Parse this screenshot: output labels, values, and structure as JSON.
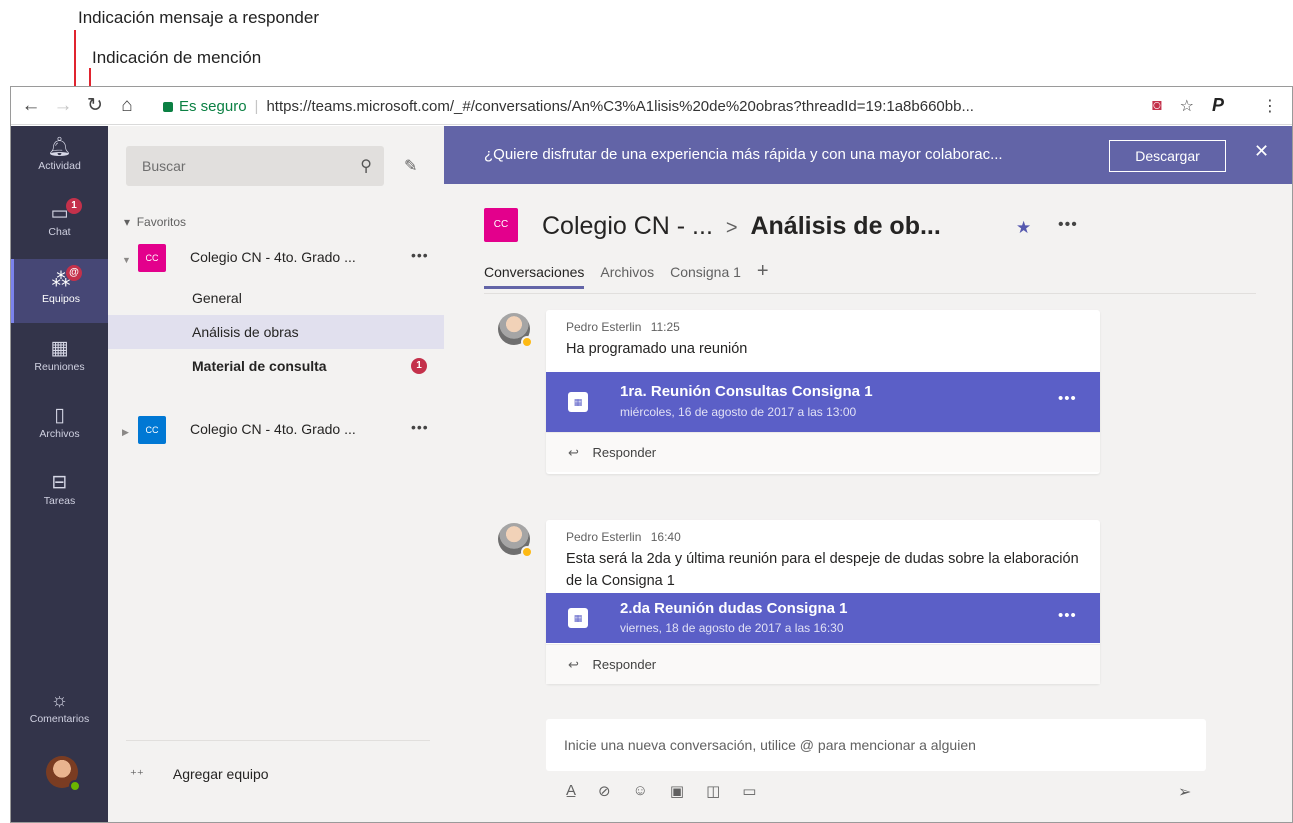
{
  "annotations": {
    "reply_indicator": "Indicación mensaje a responder",
    "mention_indicator": "Indicación de mención"
  },
  "browser": {
    "back_icon": "arrow-left",
    "forward_icon": "arrow-right",
    "reload_icon": "reload",
    "home_icon": "home",
    "secure_label": "Es seguro",
    "url": "https://teams.microsoft.com/_#/conversations/An%C3%A1lisis%20de%20obras?threadId=19:1a8b660bb...",
    "extension_p": "P"
  },
  "rail": {
    "items": [
      {
        "label": "Actividad",
        "icon": "bell"
      },
      {
        "label": "Chat",
        "icon": "chat",
        "badge": "1"
      },
      {
        "label": "Equipos",
        "icon": "teams",
        "badge": "@"
      },
      {
        "label": "Reuniones",
        "icon": "calendar"
      },
      {
        "label": "Archivos",
        "icon": "file"
      },
      {
        "label": "Tareas",
        "icon": "tasks"
      },
      {
        "label": "Comentarios",
        "icon": "lightbulb"
      }
    ]
  },
  "leftpane": {
    "search_placeholder": "Buscar",
    "favorites_label": "Favoritos",
    "teams": [
      {
        "initials": "CC",
        "name": "Colegio CN - 4to. Grado ...",
        "color": "#e3008c"
      },
      {
        "initials": "CC",
        "name": "Colegio CN - 4to. Grado ...",
        "color": "#0078d4"
      }
    ],
    "channels": [
      {
        "name": "General"
      },
      {
        "name": "Análisis de obras"
      },
      {
        "name": "Material de consulta",
        "badge": "1"
      }
    ],
    "add_team_label": "Agregar equipo"
  },
  "main": {
    "banner_text": "¿Quiere disfrutar de una experiencia más rápida y con una mayor colaborac...",
    "banner_button": "Descargar",
    "header": {
      "initials": "CC",
      "team": "Colegio CN - ...",
      "separator": ">",
      "channel": "Análisis de ob..."
    },
    "tabs": [
      "Conversaciones",
      "Archivos",
      "Consigna 1"
    ],
    "messages": [
      {
        "author": "Pedro Esterlin",
        "time": "11:25",
        "text": "Ha programado una reunión",
        "meeting_title": "1ra. Reunión Consultas Consigna 1",
        "meeting_date": "miércoles, 16 de agosto de 2017 a las 13:00",
        "reply": "Responder"
      },
      {
        "author": "Pedro Esterlin",
        "time": "16:40",
        "text": "Esta será la 2da y última reunión para el despeje de dudas sobre la elaboración de la Consigna 1",
        "meeting_title": "2.da Reunión dudas Consigna 1",
        "meeting_date": "viernes, 18 de agosto de 2017 a las 16:30",
        "reply": "Responder"
      }
    ],
    "compose_placeholder": "Inicie una nueva conversación, utilice @ para mencionar a alguien",
    "meeting_icon_glyph": "▦"
  },
  "colors": {
    "rail": "#33344a",
    "accent": "#6264a7",
    "badge": "#c4314b",
    "annotation": "#e0242f"
  }
}
